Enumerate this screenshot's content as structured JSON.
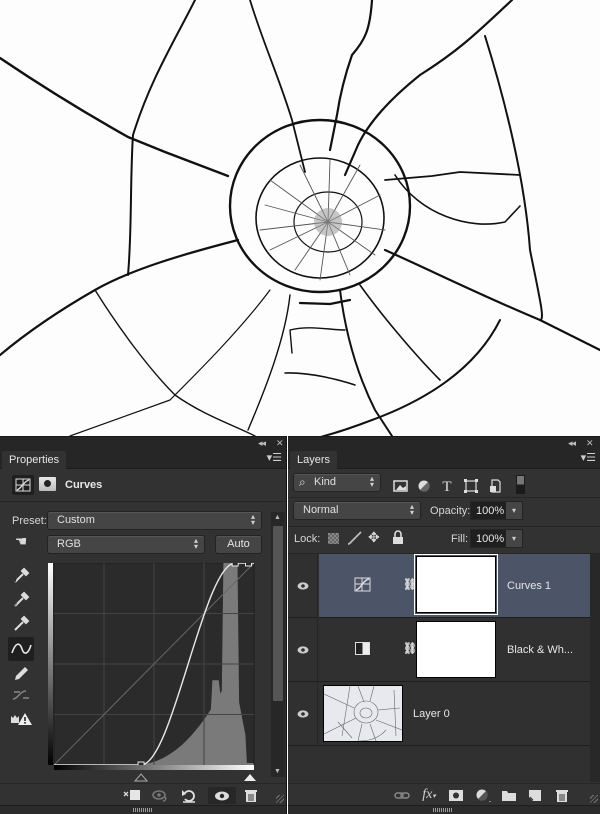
{
  "canvas": {
    "subject": "cracked glass photo (black and white)"
  },
  "properties_panel": {
    "tab": "Properties",
    "adjustment_type": "Curves",
    "adjustment_icon": "curves-grid-icon",
    "mask_icon": "layer-mask-icon",
    "preset_label": "Preset:",
    "preset_value": "Custom",
    "channel_value": "RGB",
    "auto_label": "Auto",
    "tools": [
      {
        "name": "on-image-adjust-tool",
        "icon": "hand-target-icon"
      },
      {
        "name": "black-point-eyedropper",
        "icon": "eyedropper-icon"
      },
      {
        "name": "gray-point-eyedropper",
        "icon": "eyedropper-icon"
      },
      {
        "name": "white-point-eyedropper",
        "icon": "eyedropper-icon"
      },
      {
        "name": "edit-points-curve",
        "icon": "curve-icon",
        "active": true
      },
      {
        "name": "draw-curve-pencil",
        "icon": "pencil-icon"
      },
      {
        "name": "smooth-curve",
        "icon": "smooth-icon"
      },
      {
        "name": "clipping-warning",
        "icon": "clipping-warning-icon"
      }
    ],
    "curve": {
      "channel": "RGB",
      "input_range": [
        0,
        255
      ],
      "output_range": [
        0,
        255
      ],
      "points": [
        [
          0,
          0
        ],
        [
          111,
          0
        ],
        [
          231,
          255
        ],
        [
          248,
          255
        ],
        [
          255,
          255
        ]
      ],
      "black_slider_input": 111,
      "white_slider_input": 255
    },
    "footer_buttons": [
      {
        "name": "clip-to-layer",
        "icon": "clip-to-layer-icon"
      },
      {
        "name": "view-previous-state",
        "icon": "view-previous-icon"
      },
      {
        "name": "reset-to-defaults",
        "icon": "reset-icon"
      },
      {
        "name": "toggle-visibility",
        "icon": "eye-icon"
      },
      {
        "name": "delete-adjustment",
        "icon": "trash-icon"
      }
    ]
  },
  "layers_panel": {
    "tab": "Layers",
    "filter_kind": "Kind",
    "filter_icons": [
      "pixel-filter-icon",
      "adjustment-filter-icon",
      "type-filter-icon",
      "shape-filter-icon",
      "smart-object-filter-icon",
      "filter-toggle-icon"
    ],
    "blend_mode": "Normal",
    "opacity_label": "Opacity:",
    "opacity_value": "100%",
    "lock_label": "Lock:",
    "fill_label": "Fill:",
    "fill_value": "100%",
    "layers": [
      {
        "name": "Curves 1",
        "type": "curves-adjustment",
        "visible": true,
        "selected": true
      },
      {
        "name": "Black & Wh...",
        "type": "black-white-adjustment",
        "visible": true,
        "selected": false
      },
      {
        "name": "Layer 0",
        "type": "pixel",
        "visible": true,
        "selected": false
      }
    ],
    "footer_buttons": [
      {
        "name": "link-layers",
        "icon": "link-icon"
      },
      {
        "name": "add-layer-style",
        "icon": "fx-icon"
      },
      {
        "name": "add-mask",
        "icon": "mask-icon"
      },
      {
        "name": "new-fill-adjustment",
        "icon": "adjustment-icon"
      },
      {
        "name": "new-group",
        "icon": "folder-icon"
      },
      {
        "name": "new-layer",
        "icon": "new-layer-icon"
      },
      {
        "name": "delete-layer",
        "icon": "trash-icon"
      }
    ]
  }
}
